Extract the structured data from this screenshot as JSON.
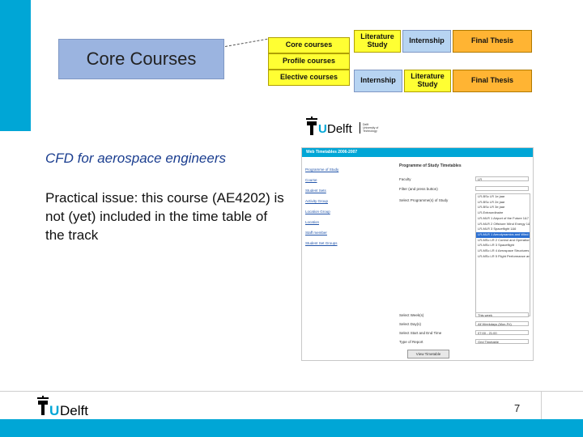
{
  "diagram": {
    "core_label": "Core Courses",
    "track_rows": [
      {
        "label": "Core courses",
        "color": "#ffff33"
      },
      {
        "label": "Profile courses",
        "color": "#ffff33"
      },
      {
        "label": "Elective courses",
        "color": "#ffff33"
      }
    ],
    "top_row": {
      "lit": "Literature Study",
      "intern": "Internship",
      "thesis": "Final Thesis"
    },
    "bottom_row": {
      "intern": "Internship",
      "lit": "Literature Study",
      "thesis": "Final Thesis"
    }
  },
  "slide": {
    "course_title": "CFD for aerospace engineers",
    "issue_text": "Practical issue: this course (AE4202) is not (yet) included in the time table of the track",
    "page_number": "7"
  },
  "logo": {
    "brand": "TUDelft",
    "tu": "TU",
    "delft": "Delft"
  },
  "timetable": {
    "header": "Web Timetables 2006-2007",
    "page_title": "Programme of Study Timetables",
    "nav": [
      "Programme of Study",
      "Course",
      "Student Sets",
      "Activity Group",
      "Location Group",
      "Location",
      "Staff member",
      "Student Set Groups"
    ],
    "labels": {
      "faculty": "Faculty",
      "filter": "Filter (and press button)",
      "select_prog": "Select Programme(s) of Study"
    },
    "faculty_value": "LR",
    "programmes": [
      "LR-BSc LR 1e jaar",
      "LR-BSc LR 2e jaar",
      "LR-BSc LR 3e jaar",
      "LR-Extraordinaire",
      "LR-MLR 1 Airport of the Future 1&7",
      "LR-MLR 2 Offshore Wind Energy 1&6",
      "LR-MLR 3 Spaceflight 1&6",
      "LR-MLR 1 Aerodynamics and Wind Energy",
      "LR-MSc LR 2 Control and Operations",
      "LR-MSc LR 3 Spaceflight",
      "LR-MSc LR 4 Aerospace Structures and Materials",
      "LR-MSc LR 5 Flight Performance and Propulsion"
    ],
    "selected_index": 7,
    "options": [
      {
        "label": "Select Week(s)",
        "value": "This week"
      },
      {
        "label": "Select Day(s)",
        "value": "All Weekdays (Mon-Fri)"
      },
      {
        "label": "Select Start and End Time",
        "value": "07:00 - 21:00"
      },
      {
        "label": "Type of Report",
        "value": "Grid Timetable"
      }
    ],
    "button": "View Timetable"
  }
}
